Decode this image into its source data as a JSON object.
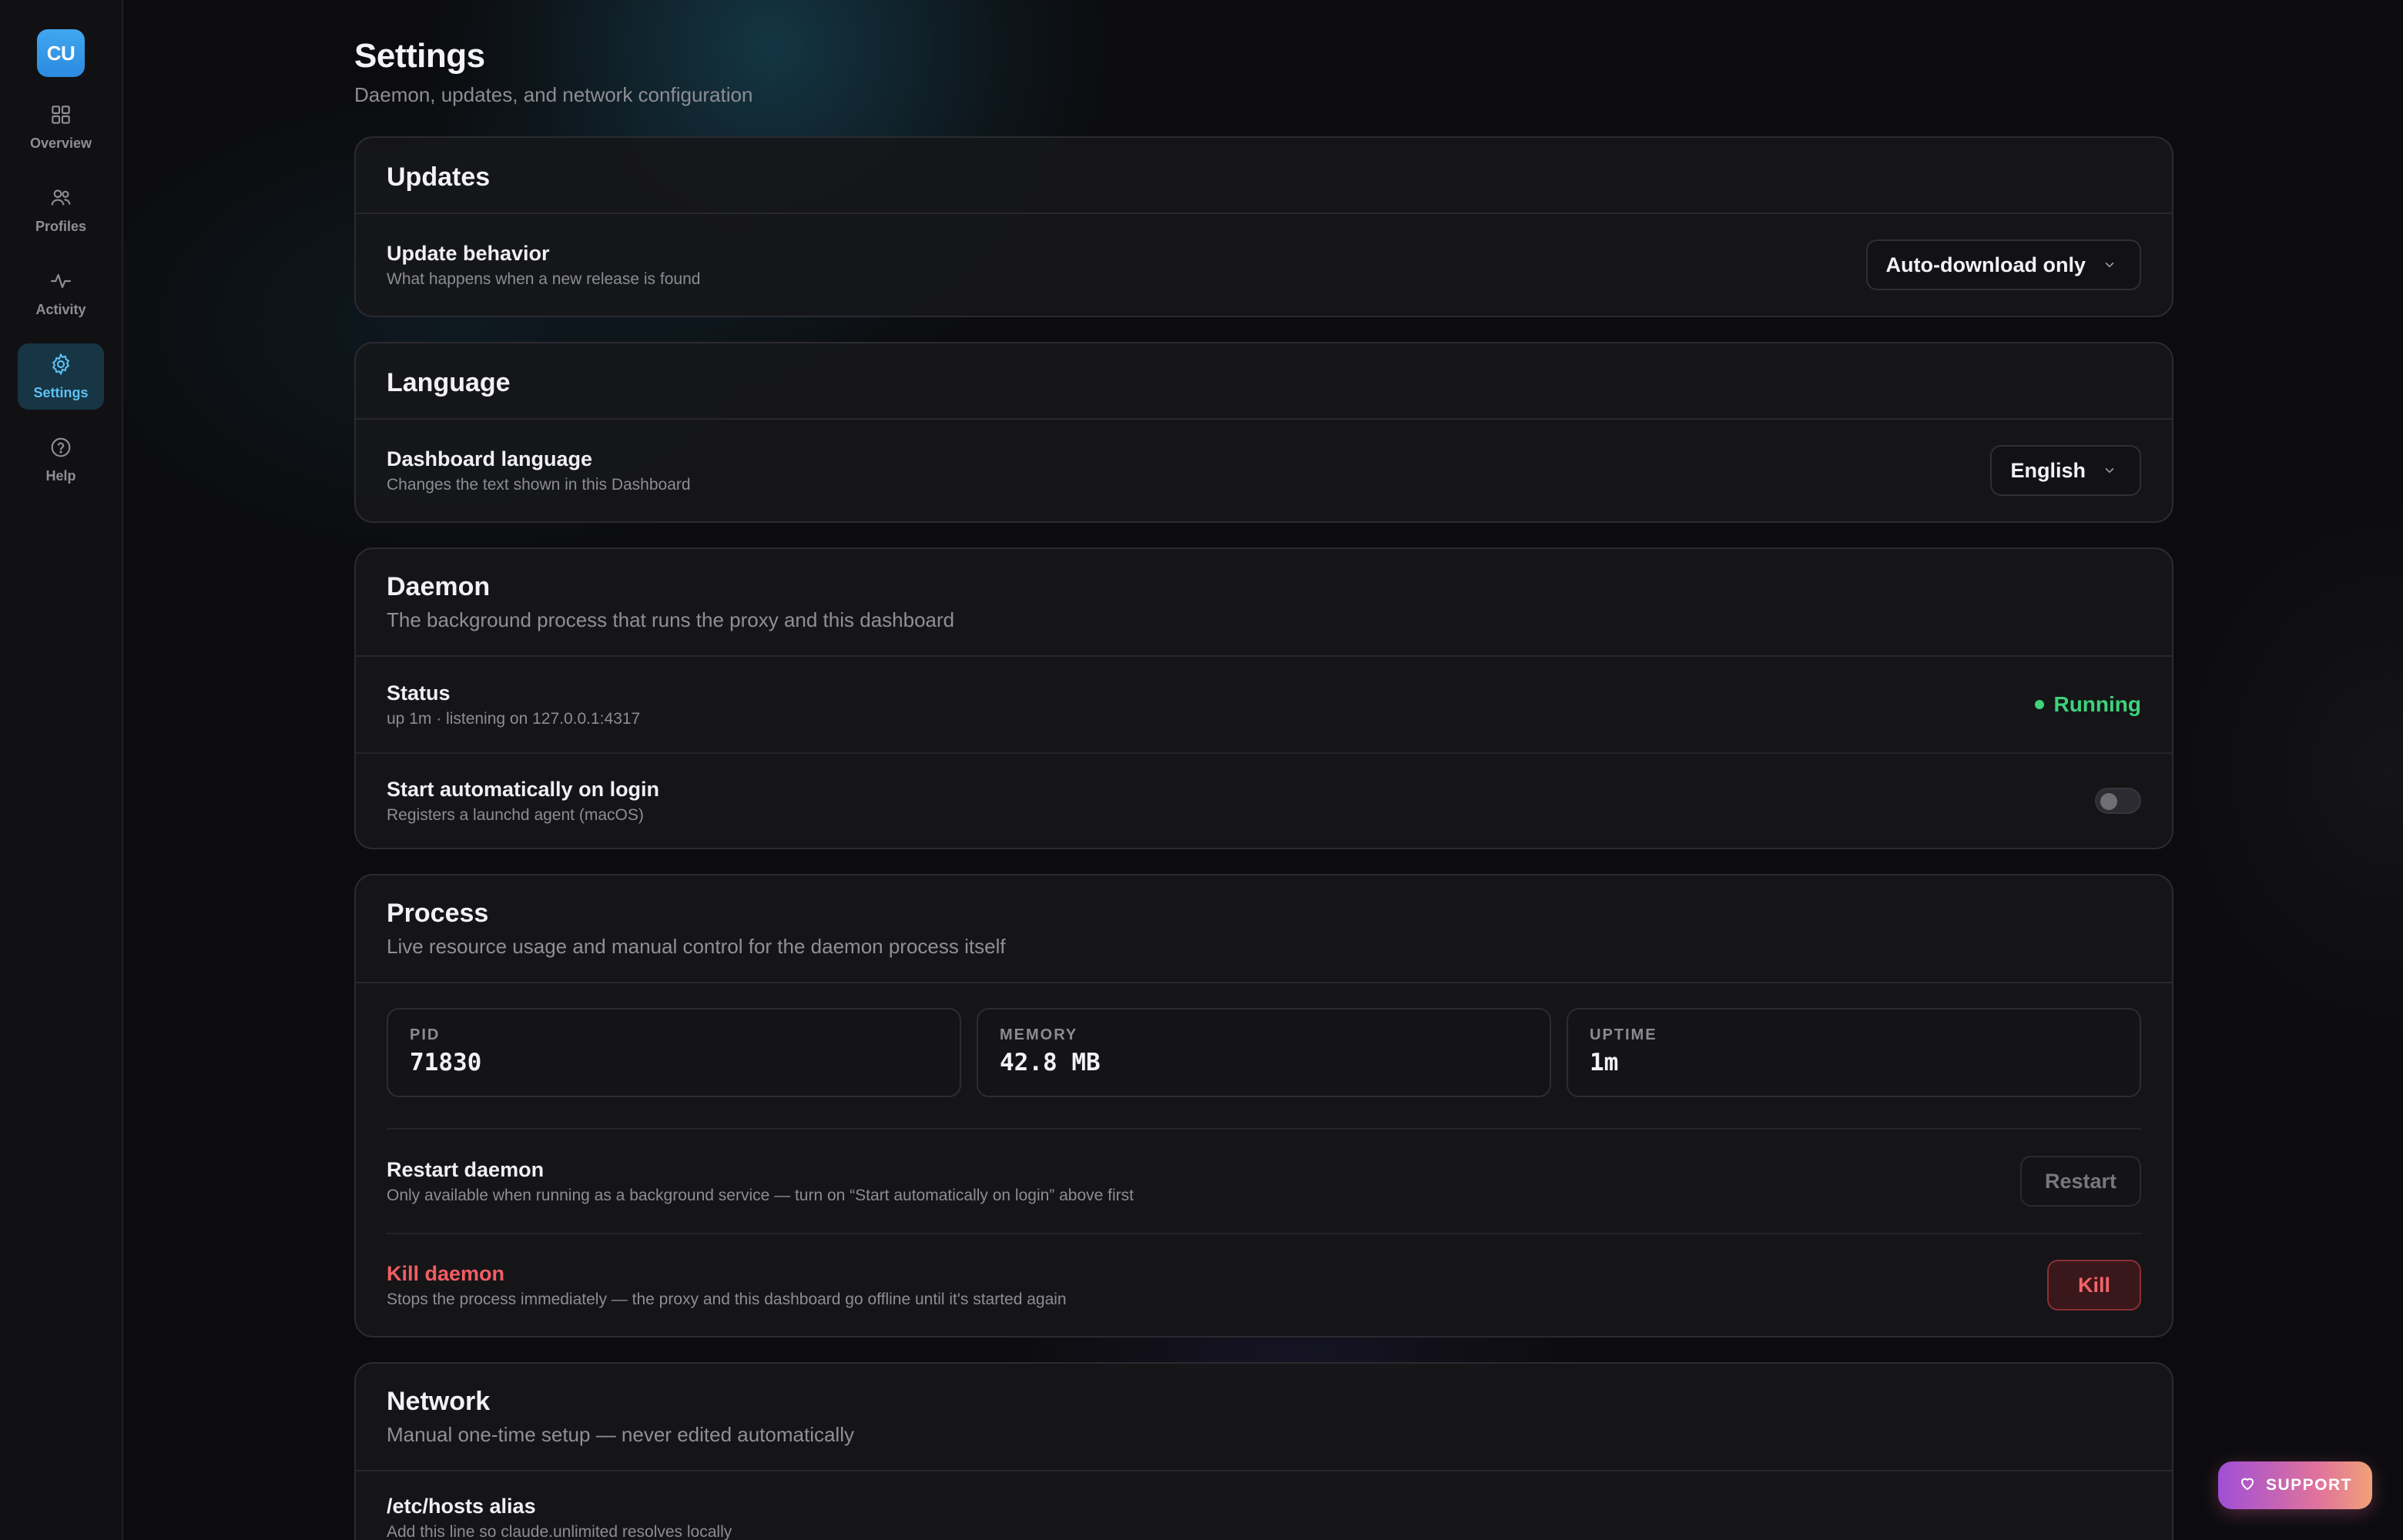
{
  "sidebar": {
    "logo": "CU",
    "items": [
      {
        "label": "Overview",
        "icon": "grid-icon"
      },
      {
        "label": "Profiles",
        "icon": "users-icon"
      },
      {
        "label": "Activity",
        "icon": "pulse-icon"
      },
      {
        "label": "Settings",
        "icon": "gear-icon",
        "active": true
      },
      {
        "label": "Help",
        "icon": "help-circle-icon"
      }
    ]
  },
  "page": {
    "title": "Settings",
    "subtitle": "Daemon, updates, and network configuration"
  },
  "updates": {
    "title": "Updates",
    "behavior_title": "Update behavior",
    "behavior_desc": "What happens when a new release is found",
    "behavior_value": "Auto-download only"
  },
  "language": {
    "title": "Language",
    "row_title": "Dashboard language",
    "row_desc": "Changes the text shown in this Dashboard",
    "value": "English"
  },
  "daemon": {
    "title": "Daemon",
    "subtitle": "The background process that runs the proxy and this dashboard",
    "status_title": "Status",
    "status_desc": "up 1m · listening on 127.0.0.1:4317",
    "status_value": "Running",
    "autostart_title": "Start automatically on login",
    "autostart_desc": "Registers a launchd agent (macOS)",
    "autostart_enabled": false
  },
  "process": {
    "title": "Process",
    "subtitle": "Live resource usage and manual control for the daemon process itself",
    "stats": [
      {
        "label": "PID",
        "value": "71830"
      },
      {
        "label": "MEMORY",
        "value": "42.8 MB"
      },
      {
        "label": "UPTIME",
        "value": "1m"
      }
    ],
    "restart_title": "Restart daemon",
    "restart_desc": "Only available when running as a background service — turn on “Start automatically on login” above first",
    "restart_button": "Restart",
    "kill_title": "Kill daemon",
    "kill_desc": "Stops the process immediately — the proxy and this dashboard go offline until it's started again",
    "kill_button": "Kill"
  },
  "network": {
    "title": "Network",
    "subtitle": "Manual one-time setup — never edited automatically",
    "hosts_title": "/etc/hosts alias",
    "hosts_desc": "Add this line so claude.unlimited resolves locally"
  },
  "support_label": "SUPPORT",
  "colors": {
    "accent": "#5cc0f2",
    "running": "#3ed27b",
    "danger": "#f25d63",
    "support_gradient": [
      "#9f4fd6",
      "#e0739c",
      "#f0a178"
    ]
  }
}
